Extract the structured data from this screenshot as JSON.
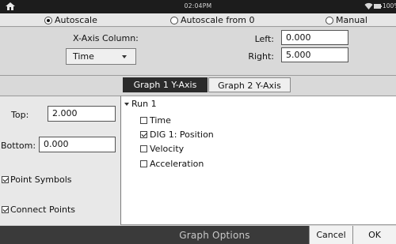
{
  "status_bar": {
    "time": "02:04PM",
    "battery_pct": "100%",
    "icons": [
      "home-icon",
      "wifi-icon",
      "battery-icon"
    ]
  },
  "scale": {
    "options": [
      "Autoscale",
      "Autoscale from 0",
      "Manual"
    ],
    "selected": "Autoscale"
  },
  "x_axis": {
    "column_label": "X-Axis Column:",
    "column_value": "Time",
    "left_label": "Left:",
    "left_value": "0.000",
    "right_label": "Right:",
    "right_value": "5.000"
  },
  "tabs": [
    {
      "label": "Graph 1 Y-Axis",
      "active": true
    },
    {
      "label": "Graph 2 Y-Axis",
      "active": false
    }
  ],
  "y_axis": {
    "top_label": "Top:",
    "top_value": "2.000",
    "bottom_label": "Bottom:",
    "bottom_value": "0.000",
    "point_symbols_label": "Point Symbols",
    "point_symbols_checked": true,
    "connect_points_label": "Connect Points",
    "connect_points_checked": true
  },
  "tree": {
    "run_label": "Run 1",
    "items": [
      {
        "label": "Time",
        "checked": false
      },
      {
        "label": "DIG 1: Position",
        "checked": true
      },
      {
        "label": "Velocity",
        "checked": false
      },
      {
        "label": "Acceleration",
        "checked": false
      }
    ]
  },
  "footer": {
    "title": "Graph Options",
    "cancel_label": "Cancel",
    "ok_label": "OK"
  },
  "colors": {
    "status_bar_bg": "#1c1c1c",
    "footer_bg": "#3a3a3a",
    "active_tab_bg": "#2b2b2b"
  }
}
